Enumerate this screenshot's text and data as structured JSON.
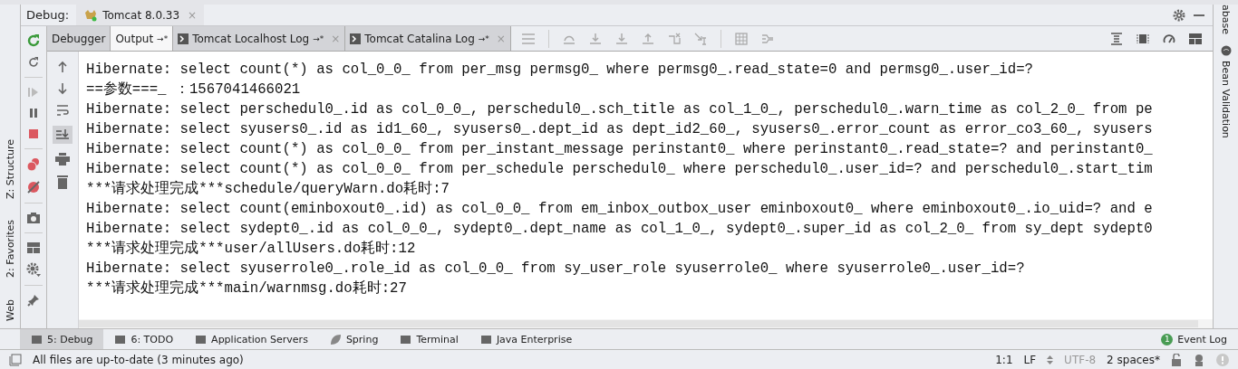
{
  "debug_header": {
    "label": "Debug:",
    "session_tab": "Tomcat 8.0.33",
    "close": "×"
  },
  "tabs": [
    {
      "label": "Debugger",
      "selected": false
    },
    {
      "label": "Output",
      "selected": true,
      "pin": "→*"
    },
    {
      "label": "Tomcat Localhost Log",
      "selected": false,
      "pin": "→*",
      "close": "×"
    },
    {
      "label": "Tomcat Catalina Log",
      "selected": false,
      "pin": "→*",
      "close": "×"
    }
  ],
  "console_lines": [
    "Hibernate: select count(*) as col_0_0_ from per_msg permsg0_ where permsg0_.read_state=0 and permsg0_.user_id=?",
    "==参数===_ ：1567041466021",
    "Hibernate: select perschedul0_.id as col_0_0_, perschedul0_.sch_title as col_1_0_, perschedul0_.warn_time as col_2_0_ from pe",
    "Hibernate: select syusers0_.id as id1_60_, syusers0_.dept_id as dept_id2_60_, syusers0_.error_count as error_co3_60_, syusers",
    "Hibernate: select count(*) as col_0_0_ from per_instant_message perinstant0_ where perinstant0_.read_state=? and perinstant0_",
    "Hibernate: select count(*) as col_0_0_ from per_schedule perschedul0_ where perschedul0_.user_id=? and perschedul0_.start_tim",
    "***请求处理完成***schedule/queryWarn.do耗时:7",
    "Hibernate: select count(eminboxout0_.id) as col_0_0_ from em_inbox_outbox_user eminboxout0_ where eminboxout0_.io_uid=? and e",
    "Hibernate: select sydept0_.id as col_0_0_, sydept0_.dept_name as col_1_0_, sydept0_.super_id as col_2_0_ from sy_dept sydept0",
    "***请求处理完成***user/allUsers.do耗时:12",
    "Hibernate: select syuserrole0_.role_id as col_0_0_ from sy_user_role syuserrole0_ where syuserrole0_.user_id=?",
    "***请求处理完成***main/warnmsg.do耗时:27"
  ],
  "left_strip": [
    "Z: Structure",
    "2: Favorites",
    "Web"
  ],
  "right_strip": [
    "abase",
    "Bean Validation"
  ],
  "tool_tabs": [
    {
      "label": "5: Debug",
      "selected": true
    },
    {
      "label": "6: TODO",
      "selected": false
    },
    {
      "label": "Application Servers",
      "selected": false
    },
    {
      "label": "Spring",
      "selected": false
    },
    {
      "label": "Terminal",
      "selected": false
    },
    {
      "label": "Java Enterprise",
      "selected": false
    }
  ],
  "event_log": {
    "count": "1",
    "label": "Event Log"
  },
  "status_bar": {
    "message": "All files are up-to-date (3 minutes ago)",
    "position": "1:1",
    "line_sep": "LF",
    "encoding": "UTF-8",
    "indent": "2 spaces*"
  }
}
